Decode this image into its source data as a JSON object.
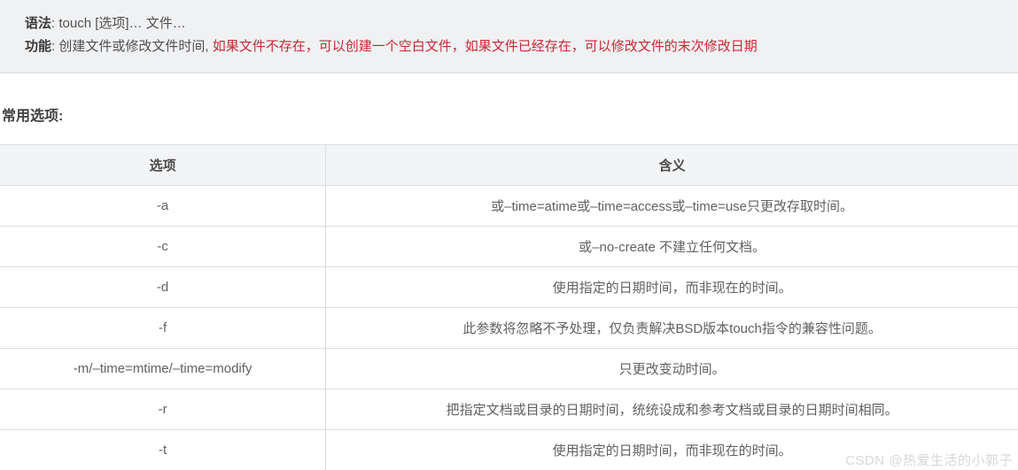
{
  "info": {
    "syntax_label": "语法",
    "syntax_value": ": touch [选项]… 文件…",
    "func_label": "功能",
    "func_value": ": 创建文件或修改文件时间, ",
    "func_red": "如果文件不存在，可以创建一个空白文件，如果文件已经存在，可以修改文件的末次修改日期"
  },
  "section": {
    "title": "常用选项:"
  },
  "table": {
    "headers": [
      "选项",
      "含义"
    ],
    "rows": [
      {
        "opt": "-a",
        "meaning": "或–time=atime或–time=access或–time=use只更改存取时间。"
      },
      {
        "opt": "-c",
        "meaning": "或–no-create 不建立任何文档。"
      },
      {
        "opt": "-d",
        "meaning": "使用指定的日期时间，而非现在的时间。"
      },
      {
        "opt": "-f",
        "meaning": "此参数将忽略不予处理，仅负责解决BSD版本touch指令的兼容性问题。"
      },
      {
        "opt": "-m/–time=mtime/–time=modify",
        "meaning": "只更改变动时间。"
      },
      {
        "opt": "-r",
        "meaning": "把指定文档或目录的日期时间，统统设成和参考文档或目录的日期时间相同。"
      },
      {
        "opt": "-t",
        "meaning": "使用指定的日期时间，而非现在的时间。"
      }
    ]
  },
  "watermark": "CSDN @热爱生活的小郭子"
}
